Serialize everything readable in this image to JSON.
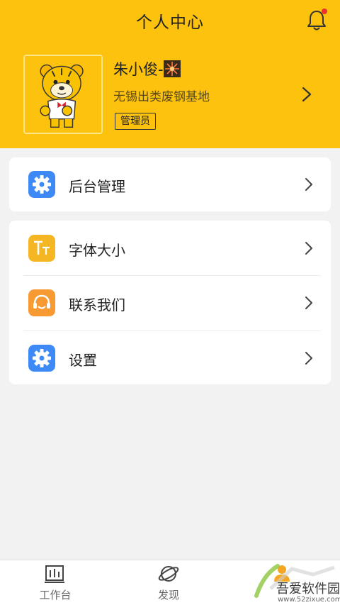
{
  "header": {
    "title": "个人中心",
    "bg_color": "#fcc20d",
    "notification_dot_color": "#e8322c"
  },
  "profile": {
    "name": "朱小俊-",
    "company": "无锡出类废钢基地",
    "role": "管理员"
  },
  "menu_group_1": [
    {
      "label": "后台管理",
      "icon": "gear-icon",
      "icon_color": "#3d8af7"
    }
  ],
  "menu_group_2": [
    {
      "label": "字体大小",
      "icon": "font-size-icon",
      "icon_color": "#f5b623"
    },
    {
      "label": "联系我们",
      "icon": "headset-icon",
      "icon_color": "#f89a32"
    },
    {
      "label": "设置",
      "icon": "gear-icon",
      "icon_color": "#3d8af7"
    }
  ],
  "tabbar": {
    "tabs": [
      {
        "label": "工作台",
        "icon": "workbench-icon"
      },
      {
        "label": "发现",
        "icon": "planet-icon"
      },
      {
        "label": "",
        "icon": "profile-icon",
        "active": true
      }
    ]
  },
  "watermark": {
    "text": "吾爱软件园",
    "url": "www.52zixue.com"
  }
}
